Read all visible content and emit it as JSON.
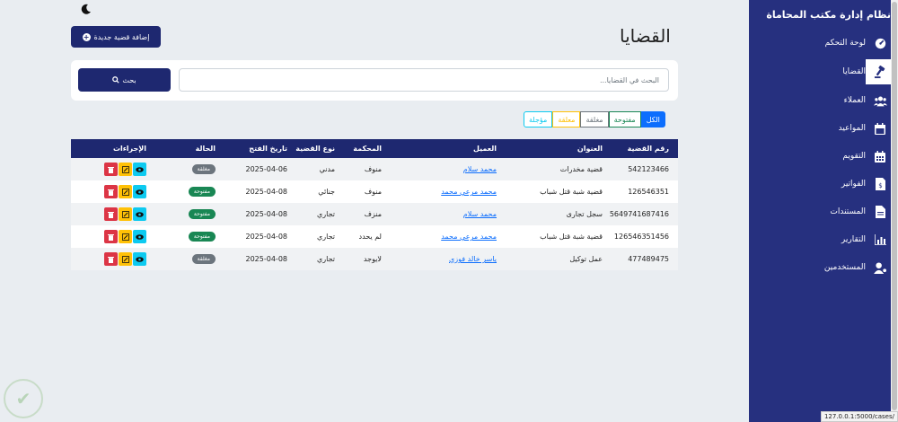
{
  "sidebar": {
    "title": "نظام إدارة مكتب المحاماة",
    "items": [
      {
        "label": "لوحة التحكم",
        "icon": "dashboard-icon"
      },
      {
        "label": "القضايا",
        "icon": "gavel-icon",
        "active": true
      },
      {
        "label": "العملاء",
        "icon": "users-icon"
      },
      {
        "label": "المواعيد",
        "icon": "calendar-icon"
      },
      {
        "label": "التقويم",
        "icon": "calendar-days-icon"
      },
      {
        "label": "الفواتير",
        "icon": "invoice-icon"
      },
      {
        "label": "المستندات",
        "icon": "document-icon"
      },
      {
        "label": "التقارير",
        "icon": "chart-icon"
      },
      {
        "label": "المستخدمين",
        "icon": "user-gear-icon"
      }
    ]
  },
  "header": {
    "title": "القضايا",
    "add_button": "إضافة قضية جديدة"
  },
  "search": {
    "placeholder": "البحث في القضايا...",
    "button": "بحث"
  },
  "filters": [
    "الكل",
    "مفتوحة",
    "مغلقة",
    "معلقة",
    "مؤجلة"
  ],
  "table": {
    "columns": [
      "رقم القضية",
      "العنوان",
      "العميل",
      "المحكمة",
      "نوع القضية",
      "تاريخ الفتح",
      "الحالة",
      "الإجراءات"
    ],
    "rows": [
      {
        "num": "542123466",
        "title": "قضية مخدرات",
        "client": "محمد سلام",
        "court": "منوف",
        "type": "مدني",
        "date": "2025-04-06",
        "status": "مغلقة",
        "status_kind": "closed"
      },
      {
        "num": "126546351",
        "title": "قضية شبة قتل شباب",
        "client": "محمد مرعي محمد",
        "court": "منوف",
        "type": "جنائي",
        "date": "2025-04-08",
        "status": "مفتوحة",
        "status_kind": "open"
      },
      {
        "num": "5649741687416",
        "title": "سجل تجارى",
        "client": "محمد سلام",
        "court": "منزف",
        "type": "تجاري",
        "date": "2025-04-08",
        "status": "مفتوحة",
        "status_kind": "open"
      },
      {
        "num": "126546351456",
        "title": "قضية شبة قتل شباب",
        "client": "محمد مرعي محمد",
        "court": "لم يحدد",
        "type": "تجاري",
        "date": "2025-04-08",
        "status": "مفتوحة",
        "status_kind": "open"
      },
      {
        "num": "477489475",
        "title": "عمل توكيل",
        "client": "ياسر خالد فوزي",
        "court": "لايوجد",
        "type": "تجاري",
        "date": "2025-04-08",
        "status": "مغلقة",
        "status_kind": "closed"
      }
    ]
  },
  "status_url": "127.0.0.1:5000/cases/"
}
